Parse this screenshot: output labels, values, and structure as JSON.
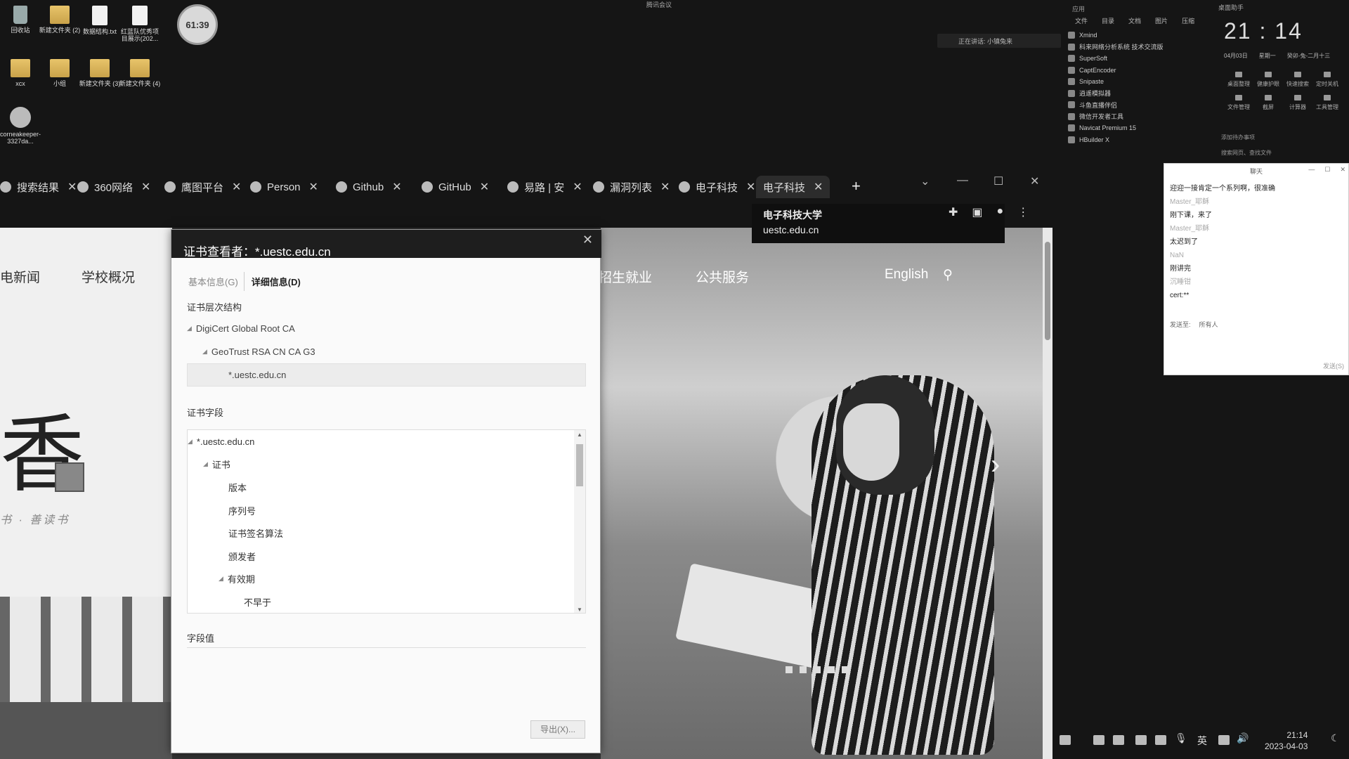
{
  "desktop": {
    "icons": [
      {
        "label": "回收站"
      },
      {
        "label": "新建文件夹 (2)"
      },
      {
        "label": "数据结构.txt"
      },
      {
        "label": "红蓝队优秀项目展示(202..."
      },
      {
        "label": "xcx"
      },
      {
        "label": "小组"
      },
      {
        "label": "新建文件夹 (3)"
      },
      {
        "label": "新建文件夹 (4)"
      },
      {
        "label": "corneakeeper-3327da..."
      }
    ],
    "timer": "61:39",
    "meeting_status": "腾讯会议",
    "speaking": "正在讲话: 小镇兔来"
  },
  "apps_panel": {
    "header": "应用",
    "tabs": [
      "文件",
      "目录",
      "文档",
      "图片",
      "压缩"
    ],
    "items": [
      "Xmind",
      "科来网络分析系统 技术交流版",
      "SuperSoft",
      "CaptEncoder",
      "Snipaste",
      "逍遥模拟器",
      "斗鱼直播伴侣",
      "微信开发者工具",
      "Navicat Premium 15",
      "HBuilder X"
    ]
  },
  "clock_panel": {
    "title": "桌面助手",
    "time": "21 : 14",
    "date": "04月03日",
    "weekday": "星期一",
    "lunar": "癸卯-兔-二月十三",
    "tools": [
      "桌面整理",
      "健康护眼",
      "快速搜索",
      "定时关机",
      "文件管理",
      "截屏",
      "计算器",
      "工具管理"
    ],
    "todo": "添加待办事项",
    "search": "搜索网页、查找文件"
  },
  "browser": {
    "tabs": [
      {
        "label": "搜索结果"
      },
      {
        "label": "360网络"
      },
      {
        "label": "鹰图平台"
      },
      {
        "label": "Person"
      },
      {
        "label": "Github"
      },
      {
        "label": "GitHub"
      },
      {
        "label": "易路 | 安"
      },
      {
        "label": "漏洞列表"
      },
      {
        "label": "电子科技"
      },
      {
        "label": "电子科技"
      }
    ],
    "tooltip_title": "电子科技大学",
    "tooltip_url": "uestc.edu.cn"
  },
  "page": {
    "nav": [
      "电新闻",
      "学校概况",
      "招生就业",
      "公共服务",
      "English"
    ],
    "big_char": "香",
    "motto": "书 · 善读书"
  },
  "cert_dialog": {
    "title": "证书查看者：*.uestc.edu.cn",
    "tabs": [
      "基本信息(G)",
      "详细信息(D)"
    ],
    "hierarchy_label": "证书层次结构",
    "hierarchy": [
      "DigiCert Global Root CA",
      "GeoTrust RSA CN CA G3",
      "*.uestc.edu.cn"
    ],
    "fields_label": "证书字段",
    "fields": [
      "*.uestc.edu.cn",
      "证书",
      "版本",
      "序列号",
      "证书签名算法",
      "颁发者",
      "有效期",
      "不早于"
    ],
    "value_label": "字段值",
    "export": "导出(X)..."
  },
  "chat": {
    "title": "聊天",
    "lines": [
      {
        "text": "迎迎一接肯定一个系列啊，很准确",
        "who": false
      },
      {
        "text": "Master_耶稣",
        "who": true
      },
      {
        "text": "刚下课，来了",
        "who": false
      },
      {
        "text": "Master_耶稣",
        "who": true
      },
      {
        "text": "太迟到了",
        "who": false
      },
      {
        "text": "NaN",
        "who": true
      },
      {
        "text": "刚讲完",
        "who": false
      },
      {
        "text": "沉睡钳",
        "who": true
      },
      {
        "text": "cert:**",
        "who": false
      }
    ],
    "send_to": "发送至:",
    "recipients": "所有人",
    "send": "发送(S)"
  },
  "taskbar": {
    "ime": "英",
    "time": "21:14",
    "date": "2023-04-03"
  }
}
